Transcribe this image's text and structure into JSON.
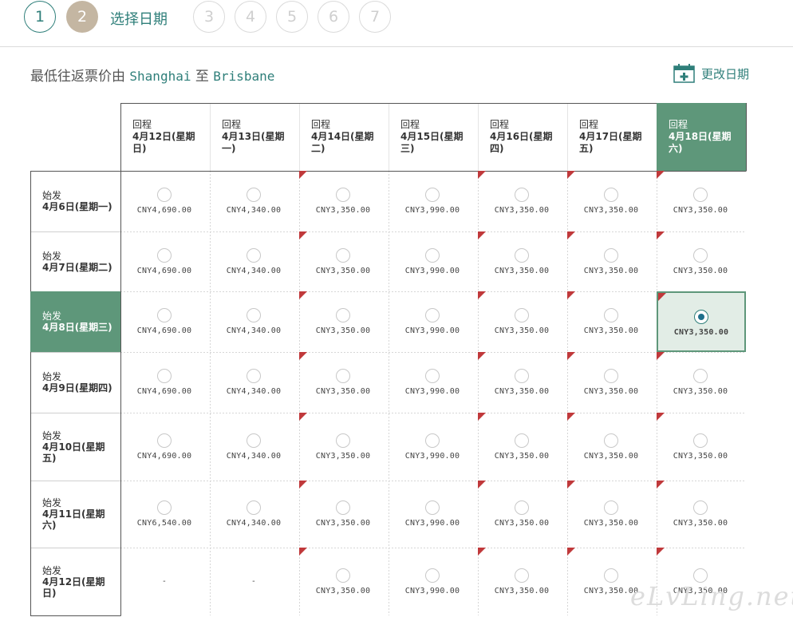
{
  "steps": [
    {
      "number": "1",
      "state": "done"
    },
    {
      "number": "2",
      "state": "current"
    },
    {
      "number": "3",
      "state": "future"
    },
    {
      "number": "4",
      "state": "future"
    },
    {
      "number": "5",
      "state": "future"
    },
    {
      "number": "6",
      "state": "future"
    },
    {
      "number": "7",
      "state": "future"
    }
  ],
  "step_label": "选择日期",
  "subhead": {
    "prefix": "最低往返票价由",
    "from": "Shanghai",
    "to_word": "至",
    "to": "Brisbane"
  },
  "change_date": {
    "label": "更改日期",
    "icon": "calendar-add-icon"
  },
  "return_label": "回程",
  "depart_label": "始发",
  "returns": [
    {
      "date": "4月12日(星期",
      "weekday": "日)"
    },
    {
      "date": "4月13日(星期",
      "weekday": "一)"
    },
    {
      "date": "4月14日(星期",
      "weekday": "二)"
    },
    {
      "date": "4月15日(星期",
      "weekday": "三)"
    },
    {
      "date": "4月16日(星期",
      "weekday": "四)"
    },
    {
      "date": "4月17日(星期",
      "weekday": "五)"
    },
    {
      "date": "4月18日(星期",
      "weekday": "六)"
    }
  ],
  "departs": [
    {
      "date": "4月6日(星期一)"
    },
    {
      "date": "4月7日(星期二)"
    },
    {
      "date": "4月8日(星期三)"
    },
    {
      "date": "4月9日(星期四)"
    },
    {
      "date": "4月10日(星期",
      "weekday": "五)"
    },
    {
      "date": "4月11日(星期",
      "weekday": "六)"
    },
    {
      "date": "4月12日(星期",
      "weekday": "日)"
    }
  ],
  "prices": [
    [
      "CNY4,690.00",
      "CNY4,340.00",
      "CNY3,350.00",
      "CNY3,990.00",
      "CNY3,350.00",
      "CNY3,350.00",
      "CNY3,350.00"
    ],
    [
      "CNY4,690.00",
      "CNY4,340.00",
      "CNY3,350.00",
      "CNY3,990.00",
      "CNY3,350.00",
      "CNY3,350.00",
      "CNY3,350.00"
    ],
    [
      "CNY4,690.00",
      "CNY4,340.00",
      "CNY3,350.00",
      "CNY3,990.00",
      "CNY3,350.00",
      "CNY3,350.00",
      "CNY3,350.00"
    ],
    [
      "CNY4,690.00",
      "CNY4,340.00",
      "CNY3,350.00",
      "CNY3,990.00",
      "CNY3,350.00",
      "CNY3,350.00",
      "CNY3,350.00"
    ],
    [
      "CNY4,690.00",
      "CNY4,340.00",
      "CNY3,350.00",
      "CNY3,990.00",
      "CNY3,350.00",
      "CNY3,350.00",
      "CNY3,350.00"
    ],
    [
      "CNY6,540.00",
      "CNY4,340.00",
      "CNY3,350.00",
      "CNY3,990.00",
      "CNY3,350.00",
      "CNY3,350.00",
      "CNY3,350.00"
    ],
    [
      "-",
      "-",
      "CNY3,350.00",
      "CNY3,990.00",
      "CNY3,350.00",
      "CNY3,350.00",
      "CNY3,350.00"
    ]
  ],
  "lowest_marker_color": "#c0393b",
  "selected": {
    "row": 2,
    "col": 6
  },
  "accent_color": "#5e977a",
  "watermark": "eLvLing.net"
}
